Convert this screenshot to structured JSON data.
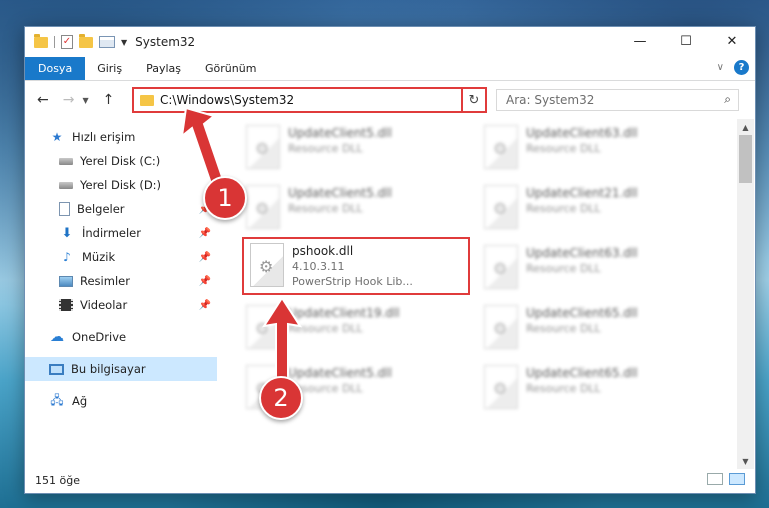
{
  "window": {
    "title": "System32",
    "controls": {
      "minimize": "—",
      "maximize": "☐",
      "close": "✕"
    }
  },
  "ribbon": {
    "tabs": [
      "Dosya",
      "Giriş",
      "Paylaş",
      "Görünüm"
    ],
    "help": "?"
  },
  "address": {
    "path": "C:\\Windows\\System32",
    "search_placeholder": "Ara: System32"
  },
  "sidebar": {
    "items": [
      {
        "label": "Hızlı erişim",
        "icon": "star-icon"
      },
      {
        "label": "Yerel Disk (C:)",
        "icon": "drive-icon"
      },
      {
        "label": "Yerel Disk (D:)",
        "icon": "drive-icon"
      },
      {
        "label": "Belgeler",
        "icon": "documents-icon",
        "pinned": true
      },
      {
        "label": "İndirmeler",
        "icon": "download-icon",
        "pinned": true
      },
      {
        "label": "Müzik",
        "icon": "music-icon",
        "pinned": true
      },
      {
        "label": "Resimler",
        "icon": "pictures-icon",
        "pinned": true
      },
      {
        "label": "Videolar",
        "icon": "videos-icon",
        "pinned": true
      },
      {
        "label": "OneDrive",
        "icon": "onedrive-icon"
      },
      {
        "label": "Bu bilgisayar",
        "icon": "this-pc-icon",
        "selected": true
      },
      {
        "label": "Ağ",
        "icon": "network-icon"
      }
    ]
  },
  "files": [
    {
      "name": "UpdateClient5.dll",
      "sub": "Resource DLL"
    },
    {
      "name": "UpdateClient63.dll",
      "sub": "Resource DLL"
    },
    {
      "name": "UpdateClient5.dll",
      "sub": "Resource DLL"
    },
    {
      "name": "UpdateClient21.dll",
      "sub": "Resource DLL"
    },
    {
      "name": "pshook.dll",
      "sub": "4.10.3.11",
      "sub2": "PowerStrip Hook Lib..."
    },
    {
      "name": "UpdateClient63.dll",
      "sub": "Resource DLL"
    },
    {
      "name": "UpdateClient19.dll",
      "sub": "Resource DLL"
    },
    {
      "name": "UpdateClient65.dll",
      "sub": "Resource DLL"
    },
    {
      "name": "UpdateClient5.dll",
      "sub": "Resource DLL"
    },
    {
      "name": "UpdateClient65.dll",
      "sub": "Resource DLL"
    }
  ],
  "status": {
    "count": "151 öğe"
  },
  "annotations": {
    "step1": "1",
    "step2": "2"
  },
  "colors": {
    "accent": "#1979ca",
    "highlight": "#e03b3b",
    "selection": "#cce8ff"
  }
}
